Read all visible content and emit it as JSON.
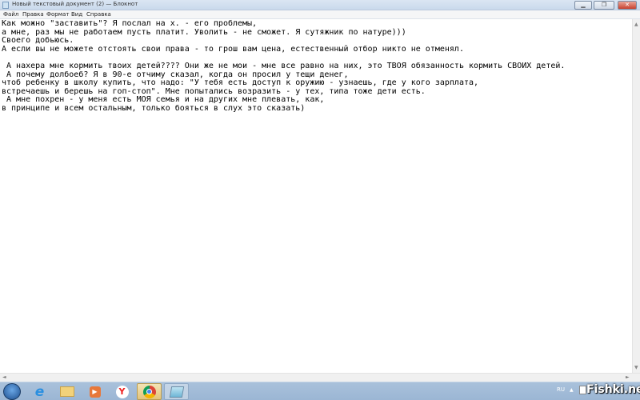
{
  "window": {
    "title": "Новый текстовый документ (2) — Блокнот",
    "minimize_icon": "minimize-icon",
    "maximize_icon": "restore-icon",
    "close_icon": "close-icon"
  },
  "menu": [
    "Файл",
    "Правка",
    "Формат",
    "Вид",
    "Справка"
  ],
  "editor": {
    "lines": [
      "Как можно \"заставить\"? Я послал на х. - его проблемы,",
      "а мне, раз мы не работаем пусть платит. Уволить - не сможет. Я сутяжник по натуре)))",
      "Своего добьюсь.",
      "А если вы не можете отстоять свои права - то грош вам цена, естественный отбор никто не отменял.",
      "",
      " А нахера мне кормить твоих детей???? Они же не мои - мне все равно на них, это ТВОЯ обязанность кормить СВОИХ детей.",
      " А почему долбоеб? Я в 90-е отчиму сказал, когда он просил у тещи денег,",
      "чтоб ребенку в школу купить, что надо: \"У тебя есть доступ к оружию - узнаешь, где у кого зарплата,",
      "встречаешь и берешь на гоп-стоп\". Мне попытались возразить - у тех, типа тоже дети есть.",
      " А мне похрен - у меня есть МОЯ семья и на других мне плевать, как,",
      "в принципе и всем остальным, только бояться в слух это сказать)"
    ]
  },
  "taskbar": {
    "items": [
      {
        "name": "internet-explorer",
        "icon": "ie-icon"
      },
      {
        "name": "explorer",
        "icon": "folder-icon"
      },
      {
        "name": "media-player",
        "icon": "media-player-icon"
      },
      {
        "name": "yandex-browser",
        "icon": "yandex-icon"
      },
      {
        "name": "chrome",
        "icon": "chrome-icon"
      },
      {
        "name": "notepad",
        "icon": "notepad-icon"
      }
    ],
    "language": "RU"
  },
  "watermark": "Fishki.net"
}
